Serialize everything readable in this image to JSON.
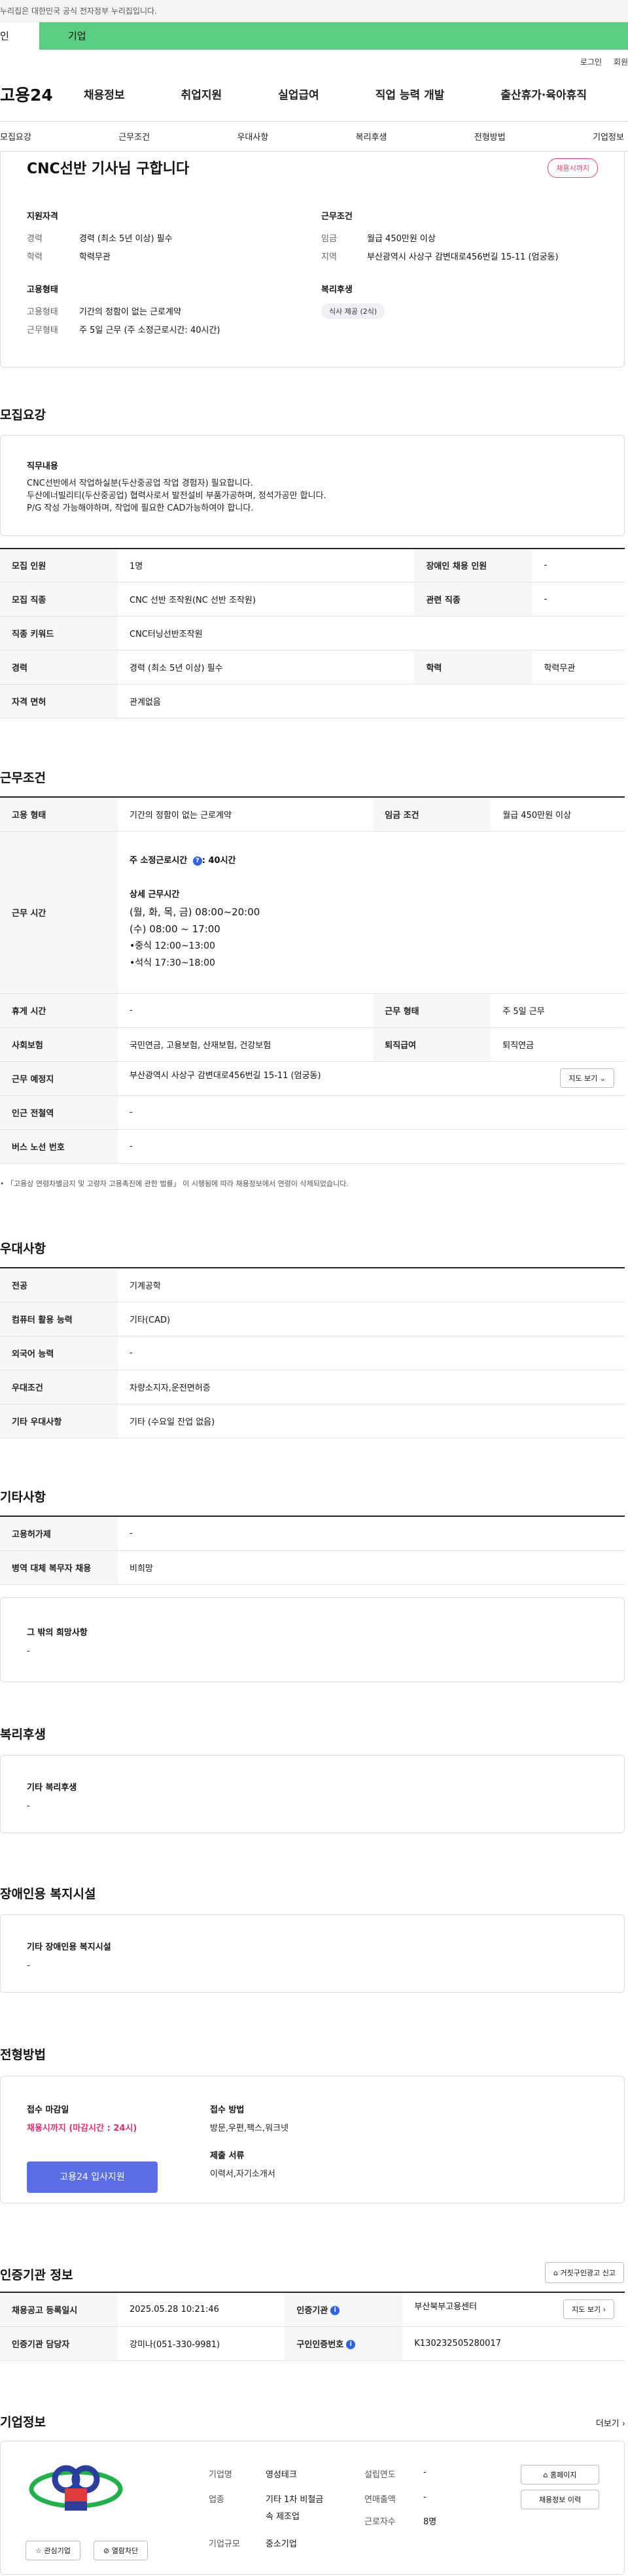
{
  "notice": "누리집은 대한민국 공식 전자정부 누리집입니다.",
  "user_tabs": {
    "personal": "인",
    "company": "기업"
  },
  "util": {
    "login": "로그인",
    "join": "회원"
  },
  "logo": "고용24",
  "gnb": [
    "채용정보",
    "취업지원",
    "실업급여",
    "직업 능력 개발",
    "출산휴가·육아휴직"
  ],
  "anchors": [
    "모집요강",
    "근무조건",
    "우대사항",
    "복리후생",
    "전형방법",
    "기업정보"
  ],
  "summary": {
    "title": "CNC선반 기사님 구합니다",
    "status": "채용시까지",
    "qual_h": "지원자격",
    "cond_h": "근무조건",
    "emp_h": "고용형태",
    "welfare_h": "복리후생",
    "career_k": "경력",
    "career_v": "경력 (최소 5년 이상) 필수",
    "edu_k": "학력",
    "edu_v": "학력무관",
    "wage_k": "임금",
    "wage_v": "월급 450만원 이상",
    "region_k": "지역",
    "region_v": "부산광역시 사상구 감변대로456번길 15-11 (엄궁동)",
    "emptype_k": "고용형태",
    "emptype_v": "기간의 정함이 없는 근로계약",
    "worktype_k": "근무형태",
    "worktype_v": "주 5일 근무 (주 소정근로시간: 40시간)",
    "welfare_chip": "식사 제공 (2식)"
  },
  "recruit": {
    "title": "모집요강",
    "duty_h": "직무내용",
    "duty_lines": [
      "CNC선반에서 작업하실분(두산중공업 작업 경험자) 필요합니다.",
      "두산에너빌리티(두산중공업) 협력사로서 발전설비 부품가공하며, 정석가공만 합니다.",
      "P/G 작성 가능해야하며, 작업에 필요한 CAD가능하여야 합니다."
    ],
    "rows": [
      [
        "모집 인원",
        "1명",
        "장애인 채용 인원",
        "-"
      ],
      [
        "모집 직종",
        "CNC 선반 조작원(NC 선반 조작원)",
        "관련 직종",
        "-"
      ],
      [
        "직종 키워드",
        "CNC터닝선반조작원"
      ],
      [
        "경력",
        "경력 (최소 5년 이상) 필수",
        "학력",
        "학력무관"
      ],
      [
        "자격 면허",
        "관계없음"
      ]
    ]
  },
  "conditions": {
    "title": "근무조건",
    "emp_k": "고용 형태",
    "emp_v": "기간의 정함이 없는 근로계약",
    "wage_k": "임금 조건",
    "wage_v": "월급 450만원 이상",
    "hours_k": "근무 시간",
    "hours_main": "주 소정근로시간 ",
    "hours_main_val": ": 40시간",
    "hours_detail_h": "상세 근무시간",
    "hours_lines": [
      "(월, 화, 목, 금) 08:00~20:00",
      "(수) 08:00 ~ 17:00",
      "•중식 12:00~13:00",
      "•석식 17:30~18:00"
    ],
    "rest_k": "휴게 시간",
    "rest_v": "-",
    "worktype_k": "근무 형태",
    "worktype_v": "주 5일 근무",
    "ins_k": "사회보험",
    "ins_v": "국민연금, 고용보험, 산재보험, 건강보험",
    "retire_k": "퇴직급여",
    "retire_v": "퇴직연금",
    "place_k": "근무 예정지",
    "place_v": "부산광역시 사상구 감변대로456번길 15-11 (엄궁동)",
    "map_btn": "지도 보기",
    "station_k": "인근 전철역",
    "station_v": "-",
    "bus_k": "버스 노선 번호",
    "bus_v": "-",
    "footnote": "「고용상 연령차별금지 및 고령자 고용촉진에 관한 법률」 이 시행됨에 따라 채용정보에서 연령이 삭제되었습니다."
  },
  "preference": {
    "title": "우대사항",
    "rows": [
      [
        "전공",
        "기계공학"
      ],
      [
        "컴퓨터 활용 능력",
        "기타(CAD)"
      ],
      [
        "외국어 능력",
        "-"
      ],
      [
        "우대조건",
        "차량소지자,운전면허증"
      ],
      [
        "기타 우대사항",
        "기타 (수요일 잔업 없음)"
      ]
    ]
  },
  "etc": {
    "title": "기타사항",
    "rows": [
      [
        "고용허가제",
        "-"
      ],
      [
        "병역 대체 복무자 채용",
        "비희망"
      ]
    ],
    "other_h": "그 밖의 희망사항",
    "other_v": "-"
  },
  "welfare": {
    "title": "복리후생",
    "h": "기타 복리후생",
    "v": "-"
  },
  "disability": {
    "title": "장애인용 복지시설",
    "h": "기타 장애인용 복지시설",
    "v": "-"
  },
  "selection": {
    "title": "전형방법",
    "deadline_h": "접수 마감일",
    "deadline_v": "채용시까지 (마감시간 : 24시)",
    "method_h": "접수 방법",
    "method_v": "방문,우편,팩스,워크넷",
    "docs_h": "제출 서류",
    "docs_v": "이력서,자기소개서",
    "apply_btn": "고용24 입사지원"
  },
  "agency": {
    "title": "인증기관 정보",
    "report_btn": "거짓구인광고 신고",
    "reg_k": "채용공고 등록일시",
    "reg_v": "2025.05.28 10:21:46",
    "agency_k": "인증기관",
    "agency_v": "부산북부고용센터",
    "manager_k": "인증기관 담당자",
    "manager_v": "강미나(051-330-9981)",
    "jobno_k": "구인인증번호",
    "jobno_v": "K130232505280017",
    "map_btn": "지도 보기"
  },
  "company": {
    "title": "기업정보",
    "more": "더보기",
    "interest_btn": "관심기업",
    "block_btn": "열람차단",
    "name_k": "기업명",
    "name_v": "영성테크",
    "industry_k": "업종",
    "industry_v1": "기타 1차 비철금",
    "industry_v2": "속 제조업",
    "size_k": "기업규모",
    "size_v": "중소기업",
    "founded_k": "설립연도",
    "founded_v": "-",
    "revenue_k": "연매출액",
    "revenue_v": "-",
    "employees_k": "근로자수",
    "employees_v": "8명",
    "homepage_btn": "홈페이지",
    "history_btn": "채용정보 이력"
  },
  "colors": {
    "accent_green": "#5bce83",
    "status_pink": "#e2436f",
    "deadline_pink": "#e0326a",
    "apply_blue": "#5a6ee8",
    "info_blue": "#2e63e6"
  }
}
